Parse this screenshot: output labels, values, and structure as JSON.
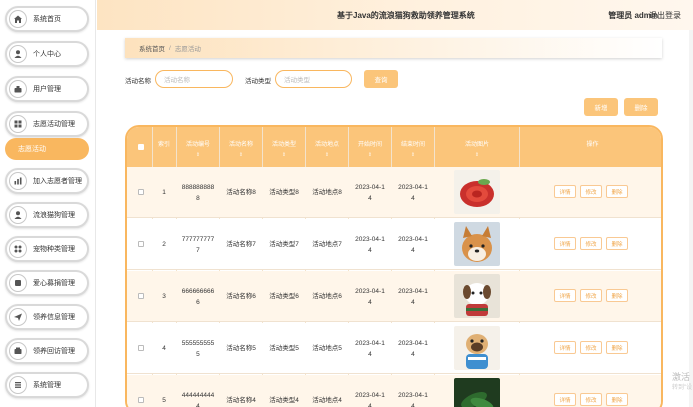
{
  "app": {
    "title": "基于Java的流浪猫狗救助领养管理系统",
    "user": "管理员 admin",
    "logout": "退出登录"
  },
  "menu": [
    {
      "label": "系统首页",
      "icon": "home-icon"
    },
    {
      "label": "个人中心",
      "icon": "user-icon"
    },
    {
      "label": "用户管理",
      "icon": "users-icon"
    },
    {
      "label": "志愿活动管理",
      "icon": "grid-icon"
    },
    {
      "label": "加入志愿者管理",
      "icon": "chart-icon"
    },
    {
      "label": "流浪猫狗管理",
      "icon": "paw-icon"
    },
    {
      "label": "宠物种类管理",
      "icon": "category-icon"
    },
    {
      "label": "爱心募捐管理",
      "icon": "heart-icon"
    },
    {
      "label": "领养信息管理",
      "icon": "send-icon"
    },
    {
      "label": "领养回访管理",
      "icon": "return-icon"
    },
    {
      "label": "系统管理",
      "icon": "settings-icon"
    }
  ],
  "submenu": {
    "label": "志愿活动"
  },
  "breadcrumb": {
    "home": "系统首页",
    "sep": "/",
    "current": "志愿活动"
  },
  "search": {
    "name_label": "活动名称",
    "name_placeholder": "活动名称",
    "type_label": "活动类型",
    "type_placeholder": "活动类型",
    "search_btn": "查询"
  },
  "actions": {
    "add": "新增",
    "delete": "删除"
  },
  "table": {
    "headers": [
      "索引",
      "活动编号",
      "活动名称",
      "活动类型",
      "活动地点",
      "开始时间",
      "结束时间",
      "活动图片",
      "操作"
    ],
    "sort_mark": "⇕",
    "ops": [
      "详情",
      "修改",
      "删除"
    ],
    "rows": [
      {
        "index": "1",
        "code": "888888888\n8",
        "name": "活动名称8",
        "type": "活动类型8",
        "place": "活动地点8",
        "start": "2023-04-1\n4",
        "end": "2023-04-1\n4",
        "img": "food"
      },
      {
        "index": "2",
        "code": "777777777\n7",
        "name": "活动名称7",
        "type": "活动类型7",
        "place": "活动地点7",
        "start": "2023-04-1\n4",
        "end": "2023-04-1\n4",
        "img": "shiba"
      },
      {
        "index": "3",
        "code": "666666666\n6",
        "name": "活动名称6",
        "type": "活动类型6",
        "place": "活动地点6",
        "start": "2023-04-1\n4",
        "end": "2023-04-1\n4",
        "img": "puppy"
      },
      {
        "index": "4",
        "code": "555555555\n5",
        "name": "活动名称5",
        "type": "活动类型5",
        "place": "活动地点5",
        "start": "2023-04-1\n4",
        "end": "2023-04-1\n4",
        "img": "pug"
      },
      {
        "index": "5",
        "code": "444444444\n4",
        "name": "活动名称4",
        "type": "活动类型4",
        "place": "活动地点4",
        "start": "2023-04-1\n4",
        "end": "2023-04-1\n4",
        "img": "green"
      }
    ]
  },
  "watermark": {
    "line1": "激活",
    "line2": "转到\"设"
  },
  "colors": {
    "accent": "#f9b75f",
    "header_bg": "#fbc57a",
    "row_alt": "#fff6ea"
  }
}
